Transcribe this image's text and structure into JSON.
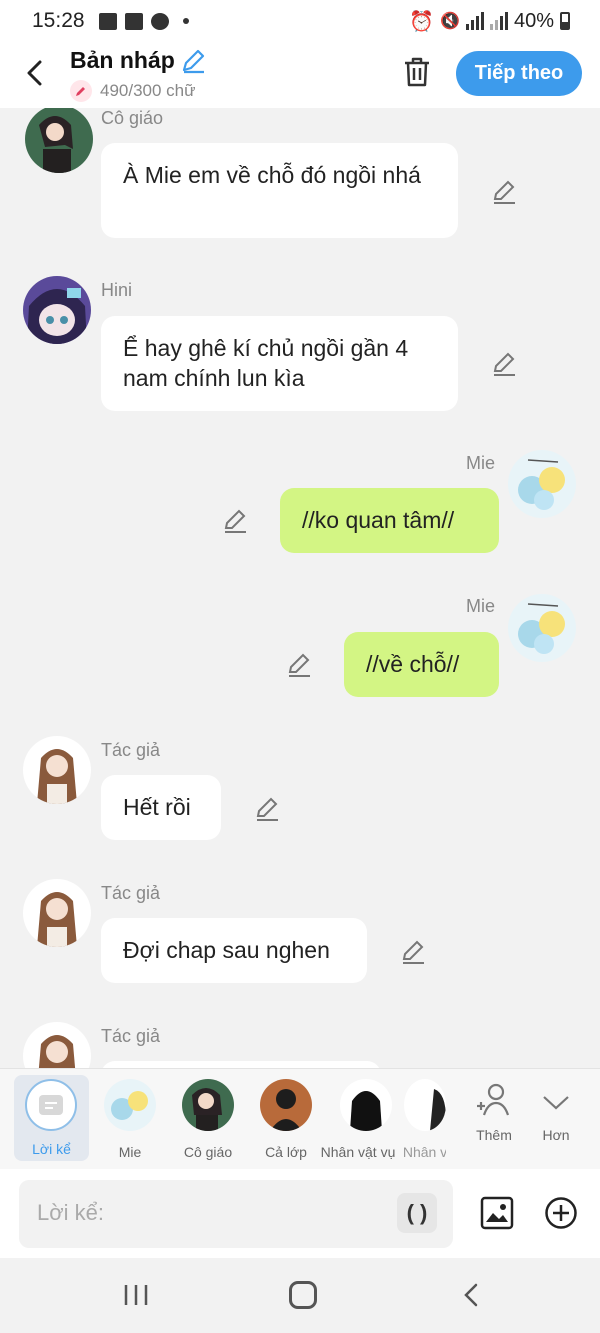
{
  "status": {
    "time": "15:28",
    "battery": "40%"
  },
  "header": {
    "title": "Bản nháp",
    "word_count": "490/300 chữ",
    "next_label": "Tiếp theo"
  },
  "messages": [
    {
      "sender": "Cô giáo",
      "text": "À Mie em về chỗ đó ngồi nhá",
      "side": "left"
    },
    {
      "sender": "Hini",
      "text": "Ể hay ghê kí chủ ngồi gần 4 nam chính lun kìa",
      "side": "left"
    },
    {
      "sender": "Mie",
      "text": "//ko quan tâm//",
      "side": "right"
    },
    {
      "sender": "Mie",
      "text": "//về chỗ//",
      "side": "right"
    },
    {
      "sender": "Tác giả",
      "text": "Hết rồi",
      "side": "left"
    },
    {
      "sender": "Tác giả",
      "text": "Đợi chap sau nghen",
      "side": "left"
    },
    {
      "sender": "Tác giả",
      "text": "",
      "side": "left"
    }
  ],
  "characters": [
    {
      "label": "Lời kể"
    },
    {
      "label": "Mie"
    },
    {
      "label": "Cô giáo"
    },
    {
      "label": "Cả lớp"
    },
    {
      "label": "Nhân vật vụ"
    },
    {
      "label": "Nhân v"
    },
    {
      "label": "Thêm"
    },
    {
      "label": "Hơn"
    }
  ],
  "input": {
    "placeholder": "Lời kể:",
    "paren": "( )"
  },
  "colors": {
    "accent": "#3d9bec",
    "bubble_right": "#d3f584",
    "bubble_left": "#ffffff"
  }
}
